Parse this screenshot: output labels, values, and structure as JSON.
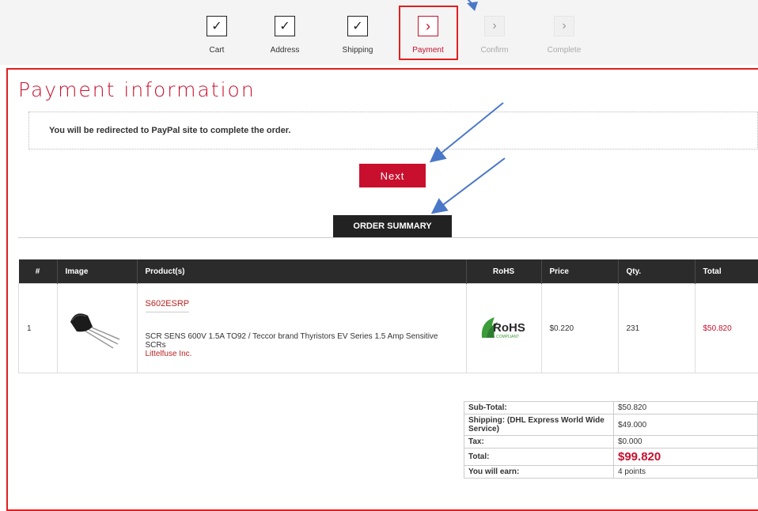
{
  "steps": [
    {
      "label": "Cart",
      "state": "done",
      "icon": "check-icon"
    },
    {
      "label": "Address",
      "state": "done",
      "icon": "check-icon"
    },
    {
      "label": "Shipping",
      "state": "done",
      "icon": "check-icon"
    },
    {
      "label": "Payment",
      "state": "current",
      "icon": "chevron-right-icon"
    },
    {
      "label": "Confirm",
      "state": "pending",
      "icon": "chevron-right-icon"
    },
    {
      "label": "Complete",
      "state": "pending",
      "icon": "chevron-right-icon"
    }
  ],
  "page": {
    "title": "Payment information",
    "notice": "You will be redirected to PayPal site to complete the order.",
    "next_label": "Next",
    "summary_label": "ORDER SUMMARY"
  },
  "table": {
    "headers": [
      "#",
      "Image",
      "Product(s)",
      "RoHS",
      "Price",
      "Qty.",
      "Total"
    ],
    "rows": [
      {
        "num": "1",
        "part": "S602ESRP",
        "desc": "SCR SENS 600V 1.5A TO92 / Teccor brand Thyristors EV Series 1.5 Amp Sensitive SCRs",
        "manufacturer": "Littelfuse Inc.",
        "rohs": "RoHS",
        "rohs_sub": "COMPLIANT",
        "price": "$0.220",
        "qty": "231",
        "total": "$50.820"
      }
    ]
  },
  "totals": [
    {
      "label": "Sub-Total:",
      "value": "$50.820"
    },
    {
      "label": "Shipping: (DHL Express World Wide Service)",
      "value": "$49.000"
    },
    {
      "label": "Tax:",
      "value": "$0.000"
    },
    {
      "label": "Total:",
      "value": "$99.820"
    },
    {
      "label": "You will earn:",
      "value": "4 points"
    }
  ],
  "colors": {
    "accent": "#c8102e",
    "highlight_outline": "#e0201f",
    "annotation_arrow": "#4a78c8"
  }
}
